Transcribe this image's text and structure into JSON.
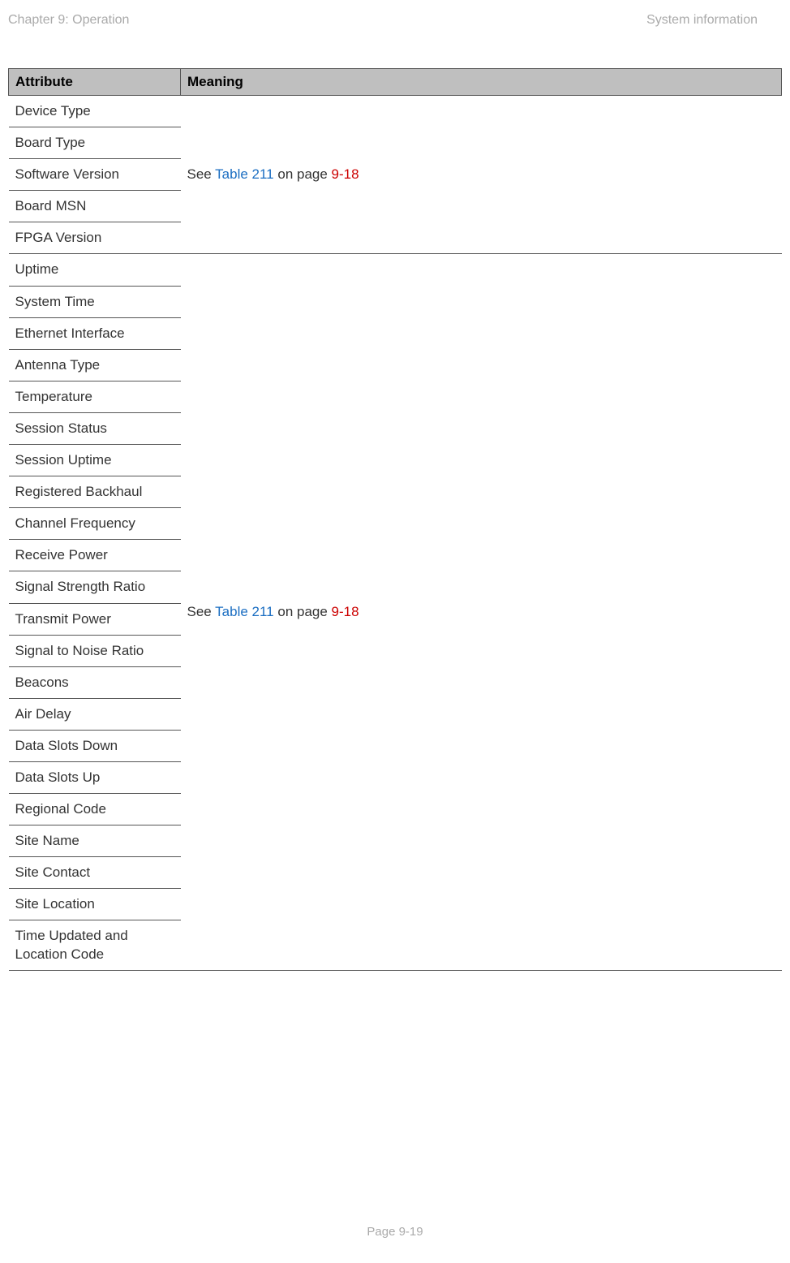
{
  "header": {
    "left": "Chapter 9:  Operation",
    "right": "System information"
  },
  "table": {
    "headers": {
      "attribute": "Attribute",
      "meaning": "Meaning"
    },
    "group1": {
      "rows": [
        "Device Type",
        "Board Type",
        "Software Version",
        "Board MSN",
        "FPGA Version"
      ],
      "meaning_prefix": "See ",
      "meaning_table": "Table 211",
      "meaning_mid": " on page ",
      "meaning_page": "9-18"
    },
    "group2": {
      "rows": [
        "Uptime",
        "System Time",
        "Ethernet Interface",
        "Antenna Type",
        "Temperature",
        "Session Status",
        "Session Uptime",
        "Registered Backhaul",
        "Channel Frequency",
        "Receive Power",
        "Signal Strength Ratio",
        "Transmit Power",
        "Signal to Noise Ratio",
        "Beacons",
        "Air Delay",
        "Data Slots Down",
        "Data Slots Up",
        "Regional Code",
        "Site Name",
        "Site Contact",
        "Site Location",
        "Time Updated and Location Code"
      ],
      "meaning_prefix": "See ",
      "meaning_table": "Table 211",
      "meaning_mid": " on page ",
      "meaning_page": "9-18"
    }
  },
  "footer": {
    "page": "Page 9-19"
  }
}
